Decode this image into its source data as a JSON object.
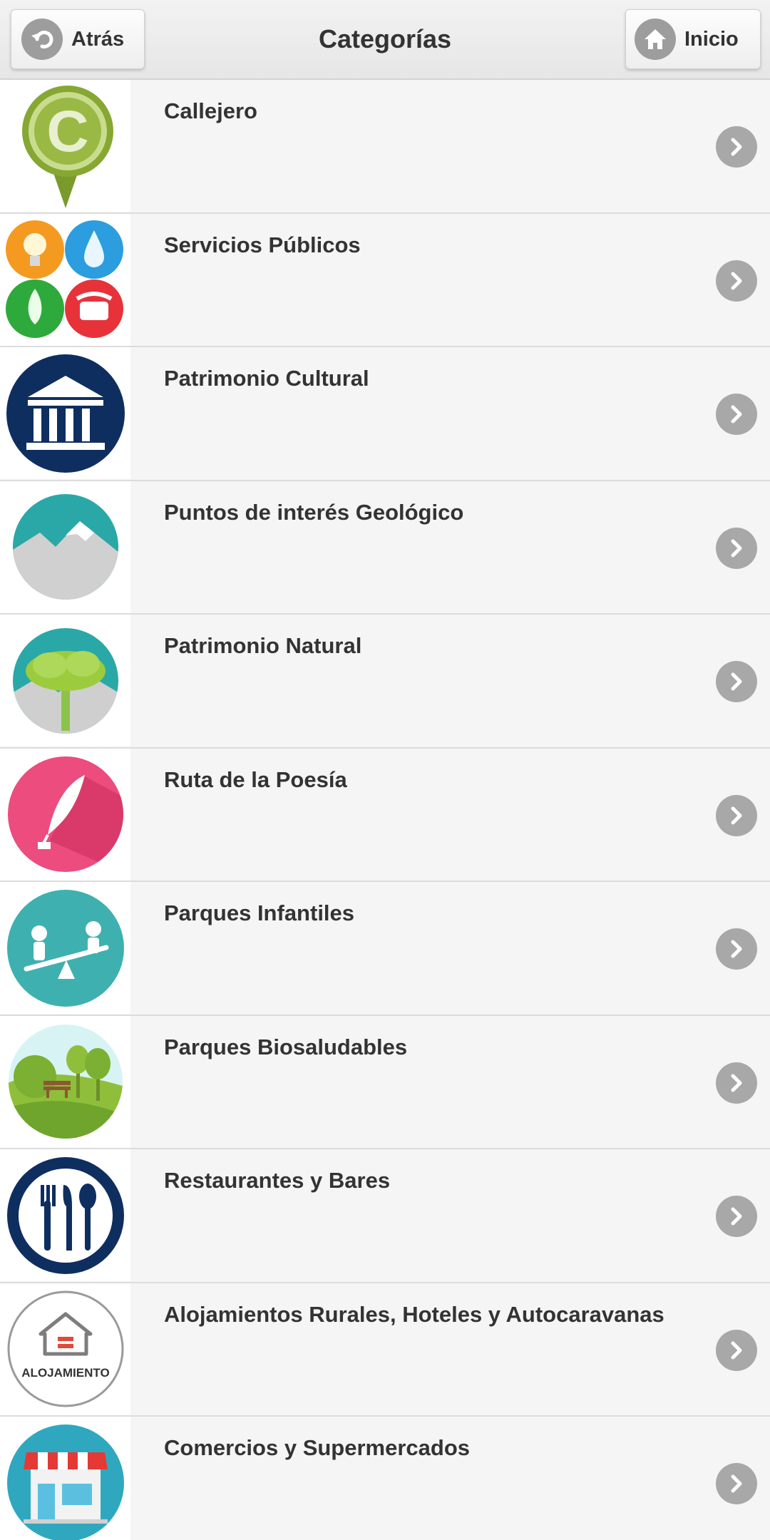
{
  "header": {
    "title": "Categorías",
    "back_label": "Atrás",
    "home_label": "Inicio"
  },
  "categories": [
    {
      "label": "Callejero",
      "icon": "map-pin-c-icon"
    },
    {
      "label": "Servicios Públicos",
      "icon": "public-services-icon"
    },
    {
      "label": "Patrimonio Cultural",
      "icon": "museum-icon"
    },
    {
      "label": "Puntos de interés Geológico",
      "icon": "mountain-icon"
    },
    {
      "label": "Patrimonio Natural",
      "icon": "tree-icon"
    },
    {
      "label": "Ruta de la Poesía",
      "icon": "quill-icon"
    },
    {
      "label": "Parques Infantiles",
      "icon": "seesaw-icon"
    },
    {
      "label": "Parques Biosaludables",
      "icon": "park-icon"
    },
    {
      "label": "Restaurantes y Bares",
      "icon": "cutlery-icon"
    },
    {
      "label": "Alojamientos Rurales, Hoteles y Autocaravanas",
      "icon": "accommodation-icon",
      "icon_text": "ALOJAMIENTO"
    },
    {
      "label": "Comercios y Supermercados",
      "icon": "shop-icon"
    }
  ],
  "colors": {
    "header_bg": "#e9e9e9",
    "row_bg": "#f5f5f5",
    "chevron_bg": "#a8a8a8",
    "text": "#333333"
  }
}
